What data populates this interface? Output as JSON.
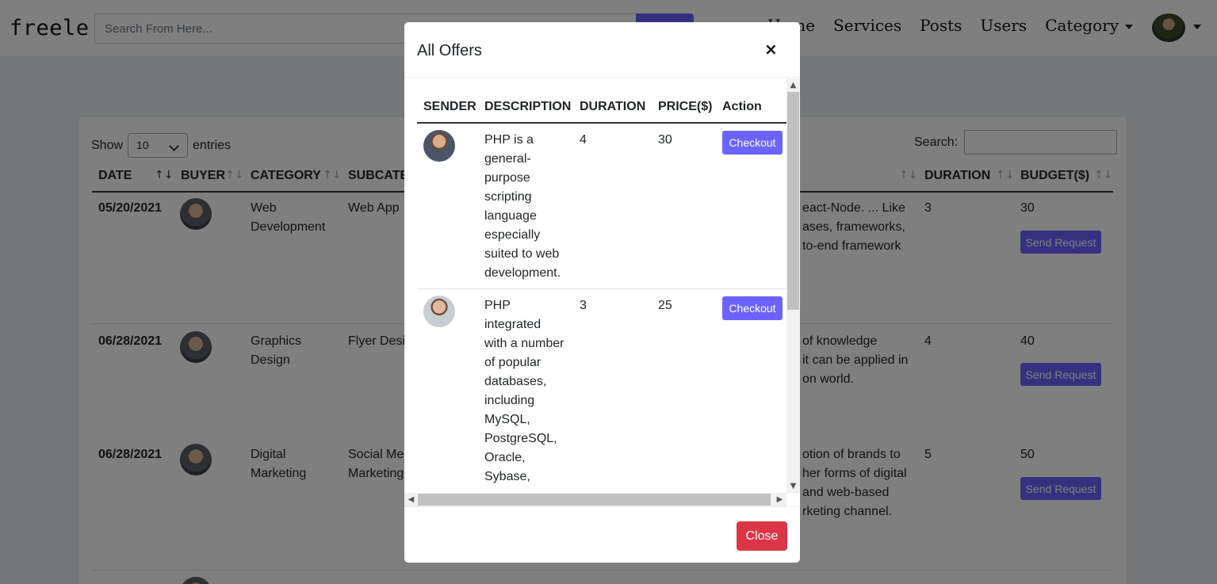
{
  "navbar": {
    "brand": "freele",
    "search_placeholder": "Search From Here...",
    "links": [
      "Home",
      "Services",
      "Posts",
      "Users",
      "Category"
    ]
  },
  "background_page": {
    "show_label": "Show",
    "entries_value": "10",
    "entries_label": "entries",
    "search_label": "Search:",
    "headers": {
      "date": "DATE",
      "buyer": "BUYER",
      "category": "CATEGORY",
      "subcategory": "SUBCATE",
      "duration": "DURATION",
      "budget": "BUDGET($)"
    },
    "rows": [
      {
        "date": "05/20/2021",
        "category_l1": "Web",
        "category_l2": "Development",
        "subcategory": "Web App",
        "desc_l1": "eact-Node. ... Like",
        "desc_l2": "ases, frameworks,",
        "desc_l3": "to-end framework",
        "duration": "3",
        "budget": "30",
        "action": "Send Request"
      },
      {
        "date": "06/28/2021",
        "category_l1": "Graphics",
        "category_l2": "Design",
        "subcategory": "Flyer Desig",
        "desc_l1": "of knowledge",
        "desc_l2": "it can be applied in",
        "desc_l3": "on world.",
        "duration": "4",
        "budget": "40",
        "action": "Send Request"
      },
      {
        "date": "06/28/2021",
        "category_l1": "Digital",
        "category_l2": "Marketing",
        "subcategory_l1": "Social Med",
        "subcategory_l2": "Marketing",
        "desc_l1": "otion of brands to",
        "desc_l2": "her forms of digital",
        "desc_l3": "and web-based",
        "desc_l4": "rketing channel.",
        "duration": "5",
        "budget": "50",
        "action": "Send Request"
      }
    ]
  },
  "modal": {
    "title": "All Offers",
    "close_x": "×",
    "headers": {
      "sender": "SENDER",
      "description": "DESCRIPTION",
      "duration": "DURATION",
      "price": "PRICE($)",
      "action": "Action"
    },
    "rows": [
      {
        "description_lines": [
          "PHP is a",
          "general-",
          "purpose",
          "scripting",
          "language",
          "especially",
          "suited to web",
          "development."
        ],
        "duration": "4",
        "price": "30",
        "action": "Checkout"
      },
      {
        "description_lines": [
          "PHP",
          "integrated",
          "with a number",
          "of popular",
          "databases,",
          "including",
          "MySQL,",
          "PostgreSQL,",
          "Oracle,",
          "Sybase,"
        ],
        "duration": "3",
        "price": "25",
        "action": "Checkout"
      }
    ],
    "close_button": "Close"
  }
}
